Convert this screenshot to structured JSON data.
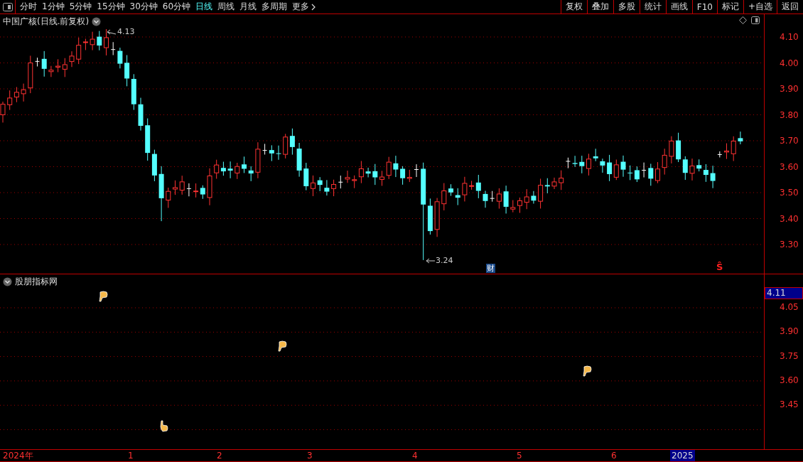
{
  "toolbar": {
    "periods": [
      {
        "label": "分时",
        "selected": false
      },
      {
        "label": "1分钟",
        "selected": false
      },
      {
        "label": "5分钟",
        "selected": false
      },
      {
        "label": "15分钟",
        "selected": false
      },
      {
        "label": "30分钟",
        "selected": false
      },
      {
        "label": "60分钟",
        "selected": false
      },
      {
        "label": "日线",
        "selected": true
      },
      {
        "label": "周线",
        "selected": false
      },
      {
        "label": "月线",
        "selected": false
      },
      {
        "label": "多周期",
        "selected": false
      },
      {
        "label": "更多",
        "selected": false
      }
    ],
    "actions": [
      "复权",
      "叠加",
      "多股",
      "统计",
      "画线",
      "F10",
      "标记",
      "+自选",
      "返回"
    ]
  },
  "main_chart": {
    "title": "中国广核(日线.前复权)",
    "high_label": "4.13",
    "low_label": "3.24",
    "event_badges": [
      {
        "label": "财",
        "kind": "finance"
      },
      {
        "label": "Ŝ",
        "kind": "signal"
      }
    ],
    "price_axis": [
      "4.10",
      "4.00",
      "3.90",
      "3.80",
      "3.70",
      "3.60",
      "3.50",
      "3.40",
      "3.30"
    ]
  },
  "indicator_panel": {
    "title": "股朋指标网",
    "current_value": "4.11",
    "value_axis": [
      "4.05",
      "3.90",
      "3.75",
      "3.60",
      "3.45"
    ]
  },
  "time_axis": [
    {
      "label": "2024年",
      "highlighted": false
    },
    {
      "label": "1",
      "highlighted": false
    },
    {
      "label": "2",
      "highlighted": false
    },
    {
      "label": "3",
      "highlighted": false
    },
    {
      "label": "4",
      "highlighted": false
    },
    {
      "label": "5",
      "highlighted": false
    },
    {
      "label": "6",
      "highlighted": false
    },
    {
      "label": "2025",
      "highlighted": true
    }
  ]
}
